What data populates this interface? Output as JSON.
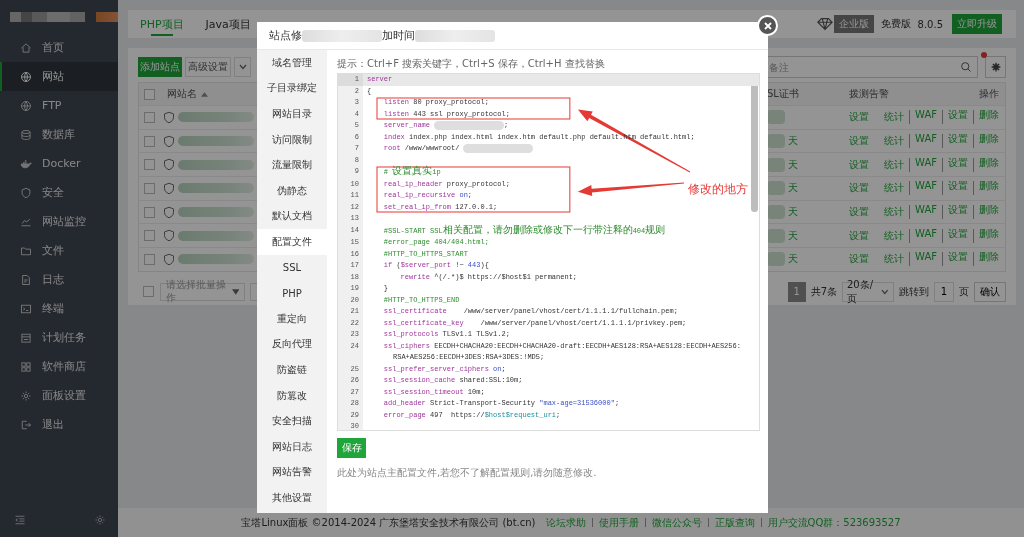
{
  "sidebar": {
    "items": [
      {
        "label": "首页",
        "selected": false
      },
      {
        "label": "网站",
        "selected": true
      },
      {
        "label": "FTP",
        "selected": false
      },
      {
        "label": "数据库",
        "selected": false
      },
      {
        "label": "Docker",
        "selected": false
      },
      {
        "label": "安全",
        "selected": false
      },
      {
        "label": "网站监控",
        "selected": false
      },
      {
        "label": "文件",
        "selected": false
      },
      {
        "label": "日志",
        "selected": false
      },
      {
        "label": "终端",
        "selected": false
      },
      {
        "label": "计划任务",
        "selected": false
      },
      {
        "label": "软件商店",
        "selected": false
      },
      {
        "label": "面板设置",
        "selected": false
      },
      {
        "label": "退出",
        "selected": false
      }
    ]
  },
  "top_bar": {
    "tabs": [
      {
        "label": "PHP项目",
        "selected": true
      },
      {
        "label": "Java项目",
        "selected": false
      }
    ],
    "edition_badge": "企业版",
    "edition": "免费版",
    "version": "8.0.5",
    "upgrade_button": "立即升级"
  },
  "site_list": {
    "add_button": "添加站点",
    "advanced_button": "高级设置",
    "search": {
      "placeholder": "备注"
    },
    "header_checked": false,
    "columns": {
      "column_1": "网站名",
      "column_2": "SL证书",
      "column_3": "拨测告警",
      "column_4": "操作"
    },
    "rows": [
      {
        "checked": false,
        "alert": "设置",
        "actions": [
          "统计",
          "WAF",
          "设置",
          "删除"
        ]
      },
      {
        "checked": false,
        "cert": "天",
        "alert": "设置",
        "actions": [
          "统计",
          "WAF",
          "设置",
          "删除"
        ]
      },
      {
        "checked": false,
        "cert": "天",
        "alert": "设置",
        "actions": [
          "统计",
          "WAF",
          "设置",
          "删除"
        ]
      },
      {
        "checked": false,
        "cert": "天",
        "alert": "设置",
        "actions": [
          "统计",
          "WAF",
          "设置",
          "删除"
        ]
      },
      {
        "checked": false,
        "cert": "天",
        "alert": "设置",
        "actions": [
          "统计",
          "WAF",
          "设置",
          "删除"
        ]
      },
      {
        "checked": false,
        "cert": "天",
        "alert": "设置",
        "actions": [
          "统计",
          "WAF",
          "设置",
          "删除"
        ]
      },
      {
        "checked": false,
        "cert": "天",
        "alert": "设置",
        "actions": [
          "统计",
          "WAF",
          "设置",
          "删除"
        ]
      }
    ],
    "batch_checked": false,
    "batch_select": "请选择批量操作",
    "pagination": {
      "current_page": "1",
      "total": "共7条",
      "page_size": "20条/页",
      "jump_label": "跳转到",
      "jump_value": "1",
      "page_unit": "页",
      "confirm": "确认"
    }
  },
  "modal": {
    "title_parts": [
      "站点修",
      "加时间"
    ],
    "nav": [
      {
        "label": "域名管理",
        "selected": false
      },
      {
        "label": "子目录绑定",
        "selected": false
      },
      {
        "label": "网站目录",
        "selected": false
      },
      {
        "label": "访问限制",
        "selected": false
      },
      {
        "label": "流量限制",
        "selected": false
      },
      {
        "label": "伪静态",
        "selected": false
      },
      {
        "label": "默认文档",
        "selected": false
      },
      {
        "label": "配置文件",
        "selected": true
      },
      {
        "label": "SSL",
        "selected": false
      },
      {
        "label": "PHP",
        "selected": false
      },
      {
        "label": "重定向",
        "selected": false
      },
      {
        "label": "反向代理",
        "selected": false
      },
      {
        "label": "防盗链",
        "selected": false
      },
      {
        "label": "防篡改",
        "selected": false
      },
      {
        "label": "安全扫描",
        "selected": false
      },
      {
        "label": "网站日志",
        "selected": false
      },
      {
        "label": "网站告警",
        "selected": false
      },
      {
        "label": "其他设置",
        "selected": false
      }
    ],
    "hint": "提示：Ctrl+F 搜索关键字，Ctrl+S 保存，Ctrl+H 查找替换",
    "editor": {
      "lines": [
        {
          "number": "1",
          "active": true,
          "marked": false,
          "tokens": [
            {
              "kind": "kw",
              "text": "server"
            }
          ]
        },
        {
          "number": "2",
          "active": false,
          "marked": false,
          "tokens": [
            {
              "kind": "plain",
              "text": "{"
            }
          ]
        },
        {
          "number": "3",
          "active": false,
          "marked": true,
          "tokens": [
            {
              "kind": "kw",
              "text": "    listen"
            },
            {
              "kind": "plain",
              "text": " 80 proxy_protocol;"
            }
          ]
        },
        {
          "number": "4",
          "active": false,
          "marked": true,
          "tokens": [
            {
              "kind": "kw",
              "text": "    listen"
            },
            {
              "kind": "plain",
              "text": " 443 ssl proxy_protocol;"
            }
          ]
        },
        {
          "number": "5",
          "active": false,
          "marked": false,
          "tokens": [
            {
              "kind": "kw",
              "text": "    server_name"
            },
            {
              "kind": "redacted"
            },
            {
              "kind": "plain",
              "text": ";"
            }
          ]
        },
        {
          "number": "6",
          "active": false,
          "marked": false,
          "tokens": [
            {
              "kind": "kw",
              "text": "    index"
            },
            {
              "kind": "plain",
              "text": " index.php index.html index.htm default.php default.htm default.html;"
            }
          ]
        },
        {
          "number": "7",
          "active": false,
          "marked": false,
          "tokens": [
            {
              "kind": "kw",
              "text": "    root"
            },
            {
              "kind": "plain",
              "text": " /www/wwwroot/"
            },
            {
              "kind": "redacted"
            }
          ]
        },
        {
          "number": "8",
          "active": false,
          "marked": false
        },
        {
          "number": "9",
          "active": false,
          "marked": true,
          "tokens": [
            {
              "kind": "comment",
              "text": "    # 设置真实ip"
            }
          ]
        },
        {
          "number": "10",
          "active": false,
          "marked": true,
          "tokens": [
            {
              "kind": "kw",
              "text": "    real_ip_header"
            },
            {
              "kind": "plain",
              "text": " proxy_protocol;"
            }
          ]
        },
        {
          "number": "11",
          "active": false,
          "marked": true,
          "tokens": [
            {
              "kind": "kw",
              "text": "    real_ip_recursive"
            },
            {
              "kind": "const",
              "text": " on"
            },
            {
              "kind": "plain",
              "text": ";"
            }
          ]
        },
        {
          "number": "12",
          "active": false,
          "marked": true,
          "tokens": [
            {
              "kind": "kw",
              "text": "    set_real_ip_from"
            },
            {
              "kind": "plain",
              "text": " 127.0.0.1;"
            }
          ]
        },
        {
          "number": "13",
          "active": false,
          "marked": false
        },
        {
          "number": "14",
          "active": false,
          "marked": false,
          "tokens": [
            {
              "kind": "comment",
              "text": "    #SSL-START SSL相关配置，请勿删除或修改下一行带注释的404规则"
            }
          ]
        },
        {
          "number": "15",
          "active": false,
          "marked": false,
          "tokens": [
            {
              "kind": "comment",
              "text": "    #error_page 404/404.html;"
            }
          ]
        },
        {
          "number": "16",
          "active": false,
          "marked": false,
          "tokens": [
            {
              "kind": "comment",
              "text": "    #HTTP_TO_HTTPS_START"
            }
          ]
        },
        {
          "number": "17",
          "active": false,
          "marked": false,
          "tokens": [
            {
              "kind": "kw",
              "text": "    if"
            },
            {
              "kind": "plain",
              "text": " ("
            },
            {
              "kind": "kw",
              "text": "$server_port"
            },
            {
              "kind": "plain",
              "text": " !~ "
            },
            {
              "kind": "const",
              "text": "443"
            },
            {
              "kind": "plain",
              "text": "){"
            }
          ]
        },
        {
          "number": "18",
          "active": false,
          "marked": false,
          "tokens": [
            {
              "kind": "kw",
              "text": "        rewrite"
            },
            {
              "kind": "plain",
              "text": " ^(/.*)$ https://$host$1 permanent;"
            }
          ]
        },
        {
          "number": "19",
          "active": false,
          "marked": false,
          "tokens": [
            {
              "kind": "plain",
              "text": "    }"
            }
          ]
        },
        {
          "number": "20",
          "active": false,
          "marked": false,
          "tokens": [
            {
              "kind": "comment",
              "text": "    #HTTP_TO_HTTPS_END"
            }
          ]
        },
        {
          "number": "21",
          "active": false,
          "marked": false,
          "tokens": [
            {
              "kind": "kw",
              "text": "    ssl_certificate"
            },
            {
              "kind": "plain",
              "text": "    /www/server/panel/vhost/cert/1.1.1.1/fullchain.pem;"
            }
          ]
        },
        {
          "number": "22",
          "active": false,
          "marked": false,
          "tokens": [
            {
              "kind": "kw",
              "text": "    ssl_certificate_key"
            },
            {
              "kind": "plain",
              "text": "    /www/server/panel/vhost/cert/1.1.1.1/privkey.pem;"
            }
          ]
        },
        {
          "number": "23",
          "active": false,
          "marked": false,
          "tokens": [
            {
              "kind": "kw",
              "text": "    ssl_protocols"
            },
            {
              "kind": "plain",
              "text": " TLSv1.1 TLSv1.2;"
            }
          ]
        },
        {
          "number": "24",
          "active": false,
          "marked": false,
          "tokens": [
            {
              "kind": "kw",
              "text": "    ssl_ciphers"
            },
            {
              "kind": "plain",
              "text": " EECDH+CHACHA20:EECDH+CHACHA20-draft:EECDH+AES128:RSA+AES128:EECDH+AES256:RSA+AES256:EECDH+3DES:RSA+3DES:!MD5;"
            }
          ]
        },
        {
          "number": "25",
          "active": false,
          "marked": false,
          "tokens": [
            {
              "kind": "kw",
              "text": "    ssl_prefer_server_ciphers"
            },
            {
              "kind": "const",
              "text": " on"
            },
            {
              "kind": "plain",
              "text": ";"
            }
          ]
        },
        {
          "number": "26",
          "active": false,
          "marked": false,
          "tokens": [
            {
              "kind": "kw",
              "text": "    ssl_session_cache"
            },
            {
              "kind": "plain",
              "text": " shared:SSL:10m;"
            }
          ]
        },
        {
          "number": "27",
          "active": false,
          "marked": false,
          "tokens": [
            {
              "kind": "kw",
              "text": "    ssl_session_timeout"
            },
            {
              "kind": "plain",
              "text": " 10m;"
            }
          ]
        },
        {
          "number": "28",
          "active": false,
          "marked": false,
          "tokens": [
            {
              "kind": "kw",
              "text": "    add_header"
            },
            {
              "kind": "plain",
              "text": " Strict-Transport-Security "
            },
            {
              "kind": "const",
              "text": "\"max-age=31536000\""
            },
            {
              "kind": "plain",
              "text": ";"
            }
          ]
        },
        {
          "number": "29",
          "active": false,
          "marked": false,
          "tokens": [
            {
              "kind": "kw",
              "text": "    error_page"
            },
            {
              "kind": "plain",
              "text": " 497  https://"
            },
            {
              "kind": "var",
              "text": "$host$request_uri"
            },
            {
              "kind": "plain",
              "text": ";"
            }
          ]
        },
        {
          "number": "30",
          "active": false,
          "marked": false
        }
      ]
    },
    "save_button": "保存",
    "note": "此处为站点主配置文件,若您不了解配置规则,请勿随意修改.",
    "annotation": {
      "label": "修改的地方"
    }
  },
  "footer": {
    "copyright": "宝塔Linux面板 ©2014-2024 广东堡塔安全技术有限公司 (bt.cn)",
    "links": [
      "论坛求助",
      "使用手册",
      "微信公众号",
      "正版查询",
      "用户交流QQ群：523693527"
    ]
  }
}
